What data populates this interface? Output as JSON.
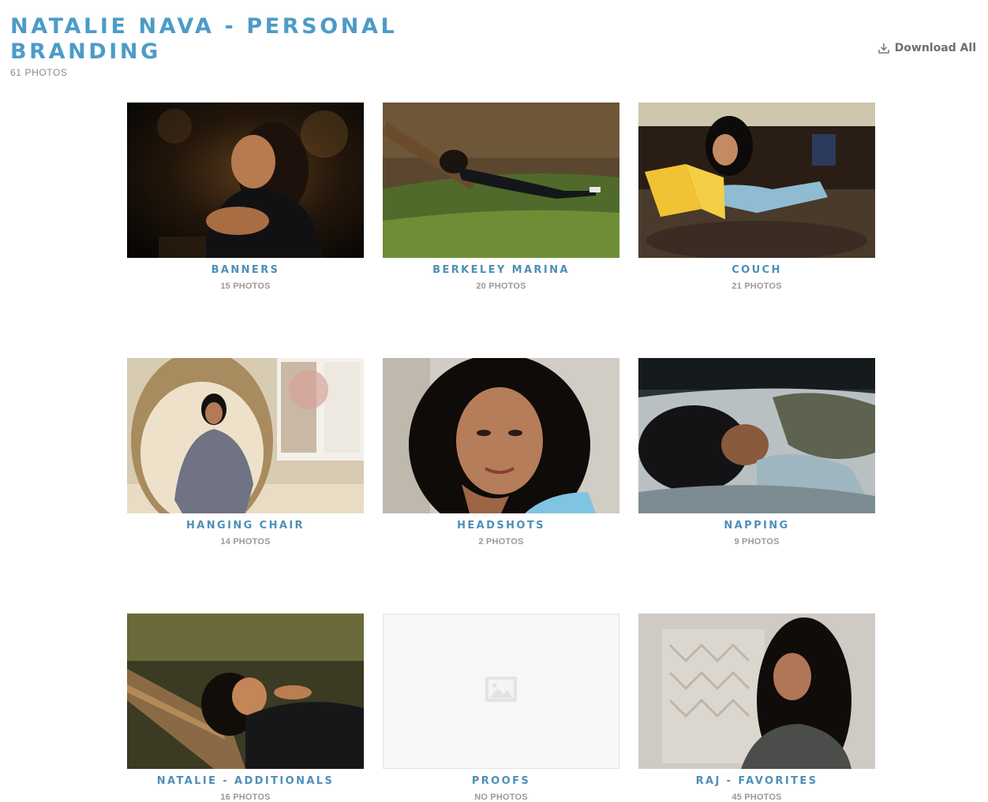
{
  "gallery": {
    "title": "NATALIE NAVA - PERSONAL BRANDING",
    "photo_count": "61 PHOTOS",
    "download_label": "Download All",
    "accent_color": "#4d9bc8"
  },
  "albums": [
    {
      "title": "BANNERS",
      "count": "15 PHOTOS"
    },
    {
      "title": "BERKELEY MARINA",
      "count": "20 PHOTOS"
    },
    {
      "title": "COUCH",
      "count": "21 PHOTOS"
    },
    {
      "title": "HANGING CHAIR",
      "count": "14 PHOTOS"
    },
    {
      "title": "HEADSHOTS",
      "count": "2 PHOTOS"
    },
    {
      "title": "NAPPING",
      "count": "9 PHOTOS"
    },
    {
      "title": "NATALIE - ADDITIONALS",
      "count": "16 PHOTOS"
    },
    {
      "title": "PROOFS",
      "count": "NO PHOTOS"
    },
    {
      "title": "RAJ - FAVORITES",
      "count": "45 PHOTOS"
    }
  ]
}
